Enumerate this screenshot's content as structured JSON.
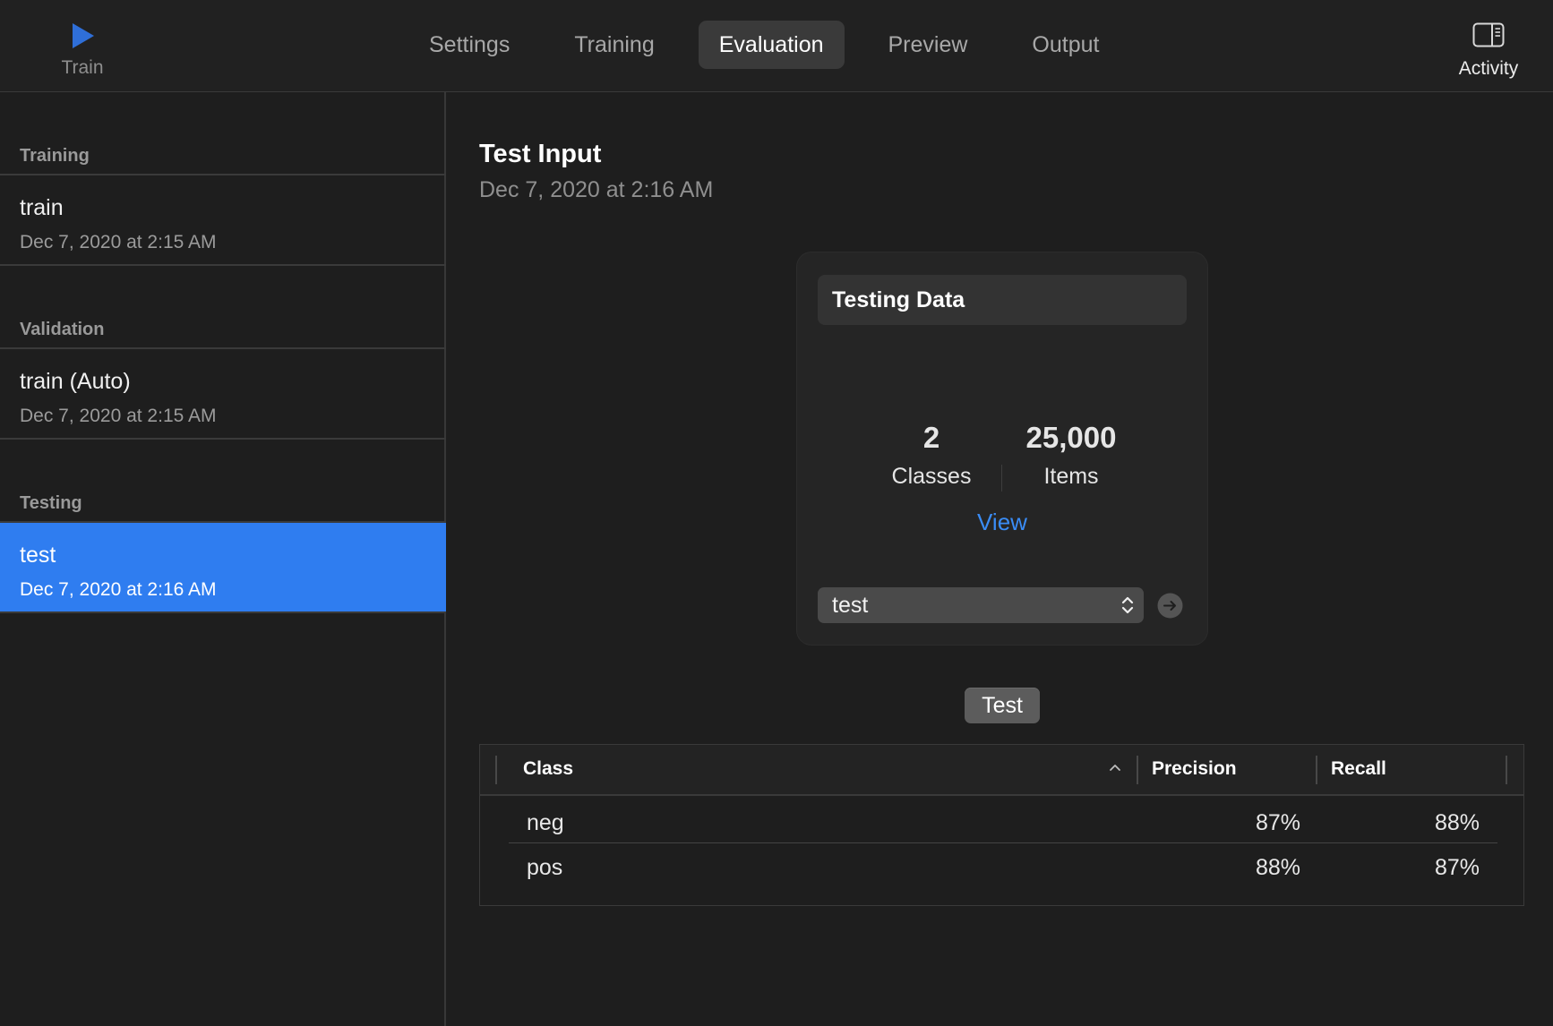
{
  "toolbar": {
    "train_label": "Train",
    "activity_label": "Activity",
    "tabs": [
      {
        "label": "Settings",
        "active": false
      },
      {
        "label": "Training",
        "active": false
      },
      {
        "label": "Evaluation",
        "active": true
      },
      {
        "label": "Preview",
        "active": false
      },
      {
        "label": "Output",
        "active": false
      }
    ]
  },
  "sidebar": {
    "sections": [
      {
        "header": "Training",
        "item": {
          "name": "train",
          "date": "Dec 7, 2020 at 2:15 AM"
        }
      },
      {
        "header": "Validation",
        "item": {
          "name": "train (Auto)",
          "date": "Dec 7, 2020 at 2:15 AM"
        }
      },
      {
        "header": "Testing",
        "item": {
          "name": "test",
          "date": "Dec 7, 2020 at 2:16 AM",
          "selected": true
        }
      }
    ]
  },
  "main": {
    "title": "Test Input",
    "date": "Dec 7, 2020 at 2:16 AM",
    "card": {
      "header": "Testing Data",
      "classes_count": "2",
      "classes_label": "Classes",
      "items_count": "25,000",
      "items_label": "Items",
      "view_link": "View",
      "selected_source": "test"
    },
    "test_button": "Test",
    "table": {
      "columns": [
        "Class",
        "Precision",
        "Recall"
      ],
      "rows": [
        {
          "class": "neg",
          "precision": "87%",
          "recall": "88%"
        },
        {
          "class": "pos",
          "precision": "88%",
          "recall": "87%"
        }
      ]
    }
  },
  "colors": {
    "accent": "#2f7df0",
    "link": "#3a8cf5",
    "background": "#1e1e1e"
  },
  "icons": [
    "play-icon",
    "sidebar-toggle-icon",
    "updown-chevron-icon",
    "arrow-right-circle-icon",
    "sort-ascending-icon"
  ]
}
